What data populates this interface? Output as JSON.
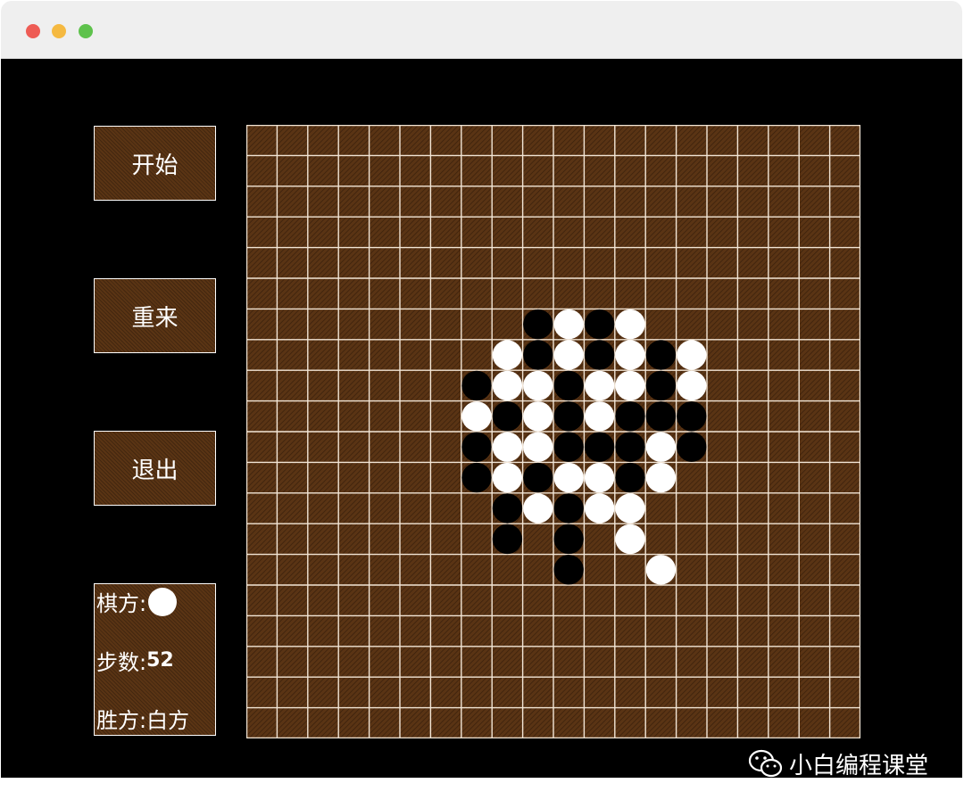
{
  "colors": {
    "board": "#5a3414",
    "grid": "#f3e6d6",
    "black_stone": "#000000",
    "white_stone": "#ffffff"
  },
  "menu": {
    "start_label": "开始",
    "restart_label": "重来",
    "exit_label": "退出"
  },
  "status": {
    "turn_label": "棋方:",
    "turn_stone": "white",
    "steps_label": "步数:",
    "steps_value": "52",
    "winner_label": "胜方:",
    "winner_value": "白方"
  },
  "board": {
    "size": 20,
    "stones": [
      {
        "row": 6,
        "col": 9,
        "color": "black"
      },
      {
        "row": 6,
        "col": 10,
        "color": "white"
      },
      {
        "row": 6,
        "col": 11,
        "color": "black"
      },
      {
        "row": 6,
        "col": 12,
        "color": "white"
      },
      {
        "row": 7,
        "col": 8,
        "color": "white"
      },
      {
        "row": 7,
        "col": 9,
        "color": "black"
      },
      {
        "row": 7,
        "col": 10,
        "color": "white"
      },
      {
        "row": 7,
        "col": 11,
        "color": "black"
      },
      {
        "row": 7,
        "col": 12,
        "color": "white"
      },
      {
        "row": 7,
        "col": 13,
        "color": "black"
      },
      {
        "row": 7,
        "col": 14,
        "color": "white"
      },
      {
        "row": 8,
        "col": 7,
        "color": "black"
      },
      {
        "row": 8,
        "col": 8,
        "color": "white"
      },
      {
        "row": 8,
        "col": 9,
        "color": "white"
      },
      {
        "row": 8,
        "col": 10,
        "color": "black"
      },
      {
        "row": 8,
        "col": 11,
        "color": "white"
      },
      {
        "row": 8,
        "col": 12,
        "color": "white"
      },
      {
        "row": 8,
        "col": 13,
        "color": "black"
      },
      {
        "row": 8,
        "col": 14,
        "color": "white"
      },
      {
        "row": 9,
        "col": 7,
        "color": "white"
      },
      {
        "row": 9,
        "col": 8,
        "color": "black"
      },
      {
        "row": 9,
        "col": 9,
        "color": "white"
      },
      {
        "row": 9,
        "col": 10,
        "color": "black"
      },
      {
        "row": 9,
        "col": 11,
        "color": "white"
      },
      {
        "row": 9,
        "col": 12,
        "color": "black"
      },
      {
        "row": 9,
        "col": 13,
        "color": "black"
      },
      {
        "row": 9,
        "col": 14,
        "color": "black"
      },
      {
        "row": 10,
        "col": 7,
        "color": "black"
      },
      {
        "row": 10,
        "col": 8,
        "color": "white"
      },
      {
        "row": 10,
        "col": 9,
        "color": "white"
      },
      {
        "row": 10,
        "col": 10,
        "color": "black"
      },
      {
        "row": 10,
        "col": 11,
        "color": "black"
      },
      {
        "row": 10,
        "col": 12,
        "color": "black"
      },
      {
        "row": 10,
        "col": 13,
        "color": "white"
      },
      {
        "row": 10,
        "col": 14,
        "color": "black"
      },
      {
        "row": 11,
        "col": 7,
        "color": "black"
      },
      {
        "row": 11,
        "col": 8,
        "color": "white"
      },
      {
        "row": 11,
        "col": 9,
        "color": "black"
      },
      {
        "row": 11,
        "col": 10,
        "color": "white"
      },
      {
        "row": 11,
        "col": 11,
        "color": "white"
      },
      {
        "row": 11,
        "col": 12,
        "color": "black"
      },
      {
        "row": 11,
        "col": 13,
        "color": "white"
      },
      {
        "row": 12,
        "col": 8,
        "color": "black"
      },
      {
        "row": 12,
        "col": 9,
        "color": "white"
      },
      {
        "row": 12,
        "col": 10,
        "color": "black"
      },
      {
        "row": 12,
        "col": 11,
        "color": "white"
      },
      {
        "row": 12,
        "col": 12,
        "color": "white"
      },
      {
        "row": 13,
        "col": 8,
        "color": "black"
      },
      {
        "row": 13,
        "col": 10,
        "color": "black"
      },
      {
        "row": 13,
        "col": 12,
        "color": "white"
      },
      {
        "row": 14,
        "col": 10,
        "color": "black"
      },
      {
        "row": 14,
        "col": 13,
        "color": "white"
      }
    ]
  },
  "watermark": {
    "text": "小白编程课堂",
    "icon": "wechat-icon"
  }
}
